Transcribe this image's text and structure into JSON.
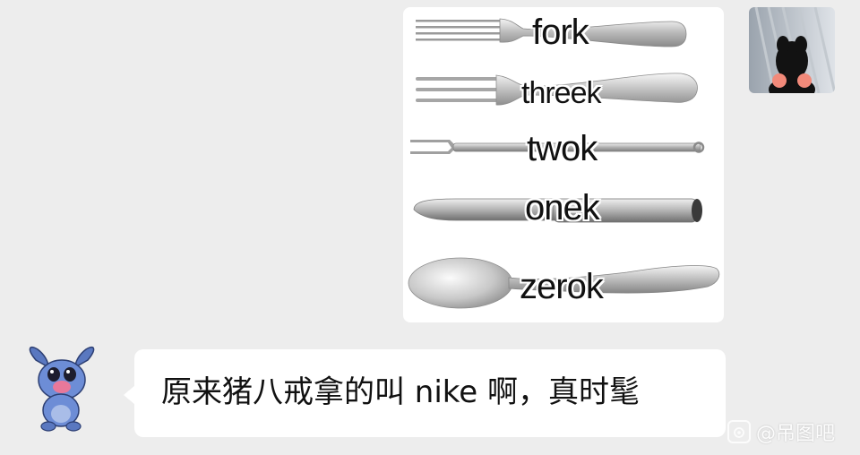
{
  "chat": {
    "background_color": "#ededed",
    "bubble_color": "#ffffff",
    "messages": [
      {
        "from": "self",
        "type": "image",
        "image": {
          "utensils": [
            {
              "icon": "fork-4-tine-icon",
              "label": "fork"
            },
            {
              "icon": "fork-3-tine-icon",
              "label": "threek"
            },
            {
              "icon": "fork-2-tine-icon",
              "label": "twok"
            },
            {
              "icon": "knife-icon",
              "label": "onek"
            },
            {
              "icon": "spoon-icon",
              "label": "zerok"
            }
          ]
        }
      },
      {
        "from": "friend",
        "type": "text",
        "text": "原来猪八戒拿的叫 nike 啊，真时髦"
      }
    ]
  },
  "avatars": {
    "self": {
      "icon": "cat-plush-avatar-icon"
    },
    "friend": {
      "icon": "stitch-sticker-avatar-icon"
    }
  },
  "watermark": {
    "icon": "weibo-camera-icon",
    "text": "@吊图吧"
  }
}
